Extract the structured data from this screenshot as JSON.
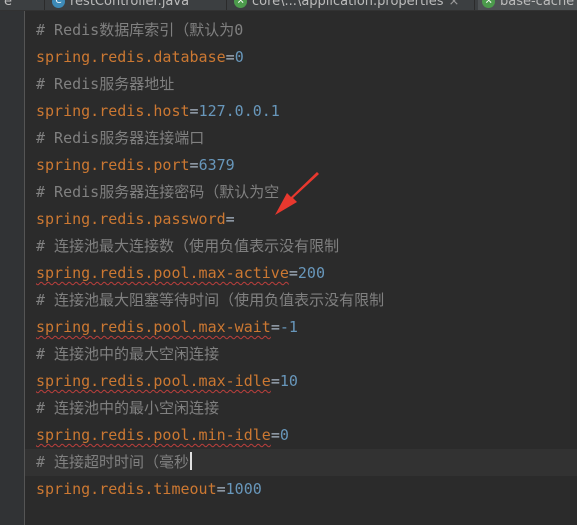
{
  "tabs": [
    {
      "label": "e",
      "icon": "",
      "active": false
    },
    {
      "label": "restController.java",
      "icon": "class-icon",
      "icon_glyph": "C",
      "active": false
    },
    {
      "label": "core\\...\\application.properties",
      "icon": "properties-icon",
      "icon_glyph": "⚒",
      "active": false
    },
    {
      "label": "base-cache",
      "icon": "properties-icon",
      "icon_glyph": "⚒",
      "active": true
    }
  ],
  "tab_close_glyph": "×",
  "colors": {
    "comment": "#808080",
    "key": "#cc7832",
    "value": "#6897bb",
    "background": "#2b2b2b",
    "annotation_arrow": "#e8382e"
  },
  "editor": {
    "lines": [
      {
        "type": "comment",
        "text": "# Redis数据库索引（默认为0"
      },
      {
        "type": "property",
        "key": "spring.redis.database",
        "eq": "=",
        "value": "0",
        "squiggle": false
      },
      {
        "type": "comment",
        "text": "# Redis服务器地址"
      },
      {
        "type": "property",
        "key": "spring.redis.host",
        "eq": "=",
        "value": "127.0.0.1",
        "squiggle": false
      },
      {
        "type": "comment",
        "text": "# Redis服务器连接端口"
      },
      {
        "type": "property",
        "key": "spring.redis.port",
        "eq": "=",
        "value": "6379",
        "squiggle": false
      },
      {
        "type": "comment",
        "text": "# Redis服务器连接密码（默认为空"
      },
      {
        "type": "property",
        "key": "spring.redis.password",
        "eq": "=",
        "value": "",
        "squiggle": false
      },
      {
        "type": "comment",
        "text": "# 连接池最大连接数（使用负值表示没有限制"
      },
      {
        "type": "property",
        "key": "spring.redis.pool.max-active",
        "eq": "=",
        "value": "200",
        "squiggle": true
      },
      {
        "type": "comment",
        "text": "# 连接池最大阻塞等待时间（使用负值表示没有限制"
      },
      {
        "type": "property",
        "key": "spring.redis.pool.max-wait",
        "eq": "=",
        "value": "-1",
        "squiggle": true
      },
      {
        "type": "comment",
        "text": "# 连接池中的最大空闲连接"
      },
      {
        "type": "property",
        "key": "spring.redis.pool.max-idle",
        "eq": "=",
        "value": "10",
        "squiggle": true
      },
      {
        "type": "comment",
        "text": "# 连接池中的最小空闲连接"
      },
      {
        "type": "property",
        "key": "spring.redis.pool.min-idle",
        "eq": "=",
        "value": "0",
        "squiggle": true
      },
      {
        "type": "comment",
        "text": "# 连接超时时间（毫秒"
      },
      {
        "type": "property",
        "key": "spring.redis.timeout",
        "eq": "=",
        "value": "1000",
        "squiggle": false
      }
    ],
    "caret_line": 16
  },
  "annotation": {
    "icon": "red-arrow-icon"
  }
}
